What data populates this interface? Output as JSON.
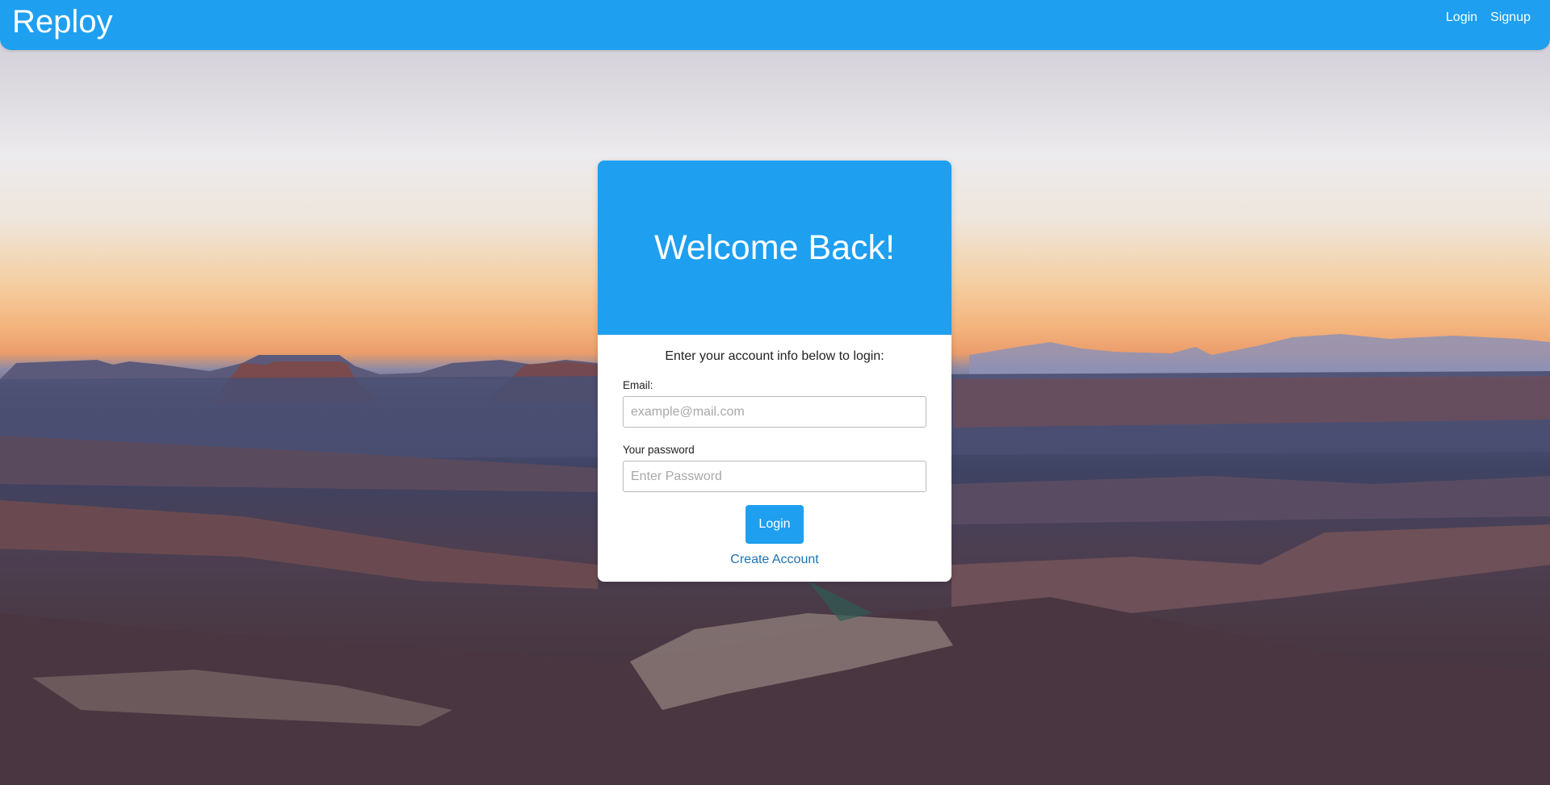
{
  "navbar": {
    "brand": "Reploy",
    "links": [
      {
        "label": "Login"
      },
      {
        "label": "Signup"
      }
    ]
  },
  "card": {
    "title": "Welcome Back!",
    "instructions": "Enter your account info below to login:",
    "email": {
      "label": "Email:",
      "placeholder": "example@mail.com",
      "value": ""
    },
    "password": {
      "label": "Your password",
      "placeholder": "Enter Password",
      "value": ""
    },
    "login_button": "Login",
    "create_account": "Create Account"
  },
  "colors": {
    "primary": "#1e9ff0",
    "link": "#1e72b3"
  }
}
